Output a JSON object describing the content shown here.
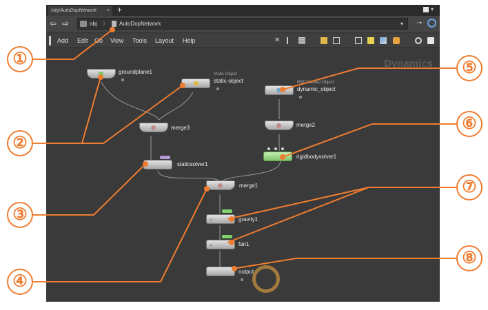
{
  "window": {
    "tab_title": "/obj/AutoDopNetwork",
    "tab_close": "×",
    "tab_add": "+"
  },
  "path_bar": {
    "back_glyph": "⇦",
    "forward_glyph": "⇨",
    "crumb_root": "obj",
    "crumb_separator": "〉",
    "crumb_current": "AutoDopNetwork",
    "dropdown_glyph": "▾"
  },
  "menu": {
    "items": [
      "Add",
      "Edit",
      "Go",
      "View",
      "Tools",
      "Layout",
      "Help"
    ]
  },
  "toolbar_icons": [
    "tools-icon",
    "tree-view-icon",
    "list-view-icon",
    "grid-icon",
    "table-icon",
    "network-icon",
    "sticky-note-icon",
    "image-icon",
    "box-icon",
    "search-icon",
    "snapshot-icon"
  ],
  "network": {
    "context_label": "Dynamics",
    "nodes": {
      "groundplane": {
        "name": "groundplane1"
      },
      "static_object": {
        "name": "static-object",
        "type_label": "Static Object"
      },
      "dynamic_object": {
        "name": "dynamic_object",
        "type_label": "RBD Packed Object"
      },
      "merge3": {
        "name": "merge3"
      },
      "merge2": {
        "name": "merge2"
      },
      "staticsolver": {
        "name": "staticsolver1"
      },
      "rigidbodysolver": {
        "name": "rigidbodysolver1"
      },
      "merge1": {
        "name": "merge1"
      },
      "gravity": {
        "name": "gravity1"
      },
      "fan": {
        "name": "fan1"
      },
      "output": {
        "name": "output"
      }
    }
  },
  "callouts": [
    "①",
    "②",
    "③",
    "④",
    "⑤",
    "⑥",
    "⑦",
    "⑧"
  ],
  "colors": {
    "accent_orange": "#ef7d31",
    "canvas_bg": "#3a3a3a",
    "display_flag_purple": "#b79ad8",
    "bypass_flag_green": "#7fd36a"
  }
}
